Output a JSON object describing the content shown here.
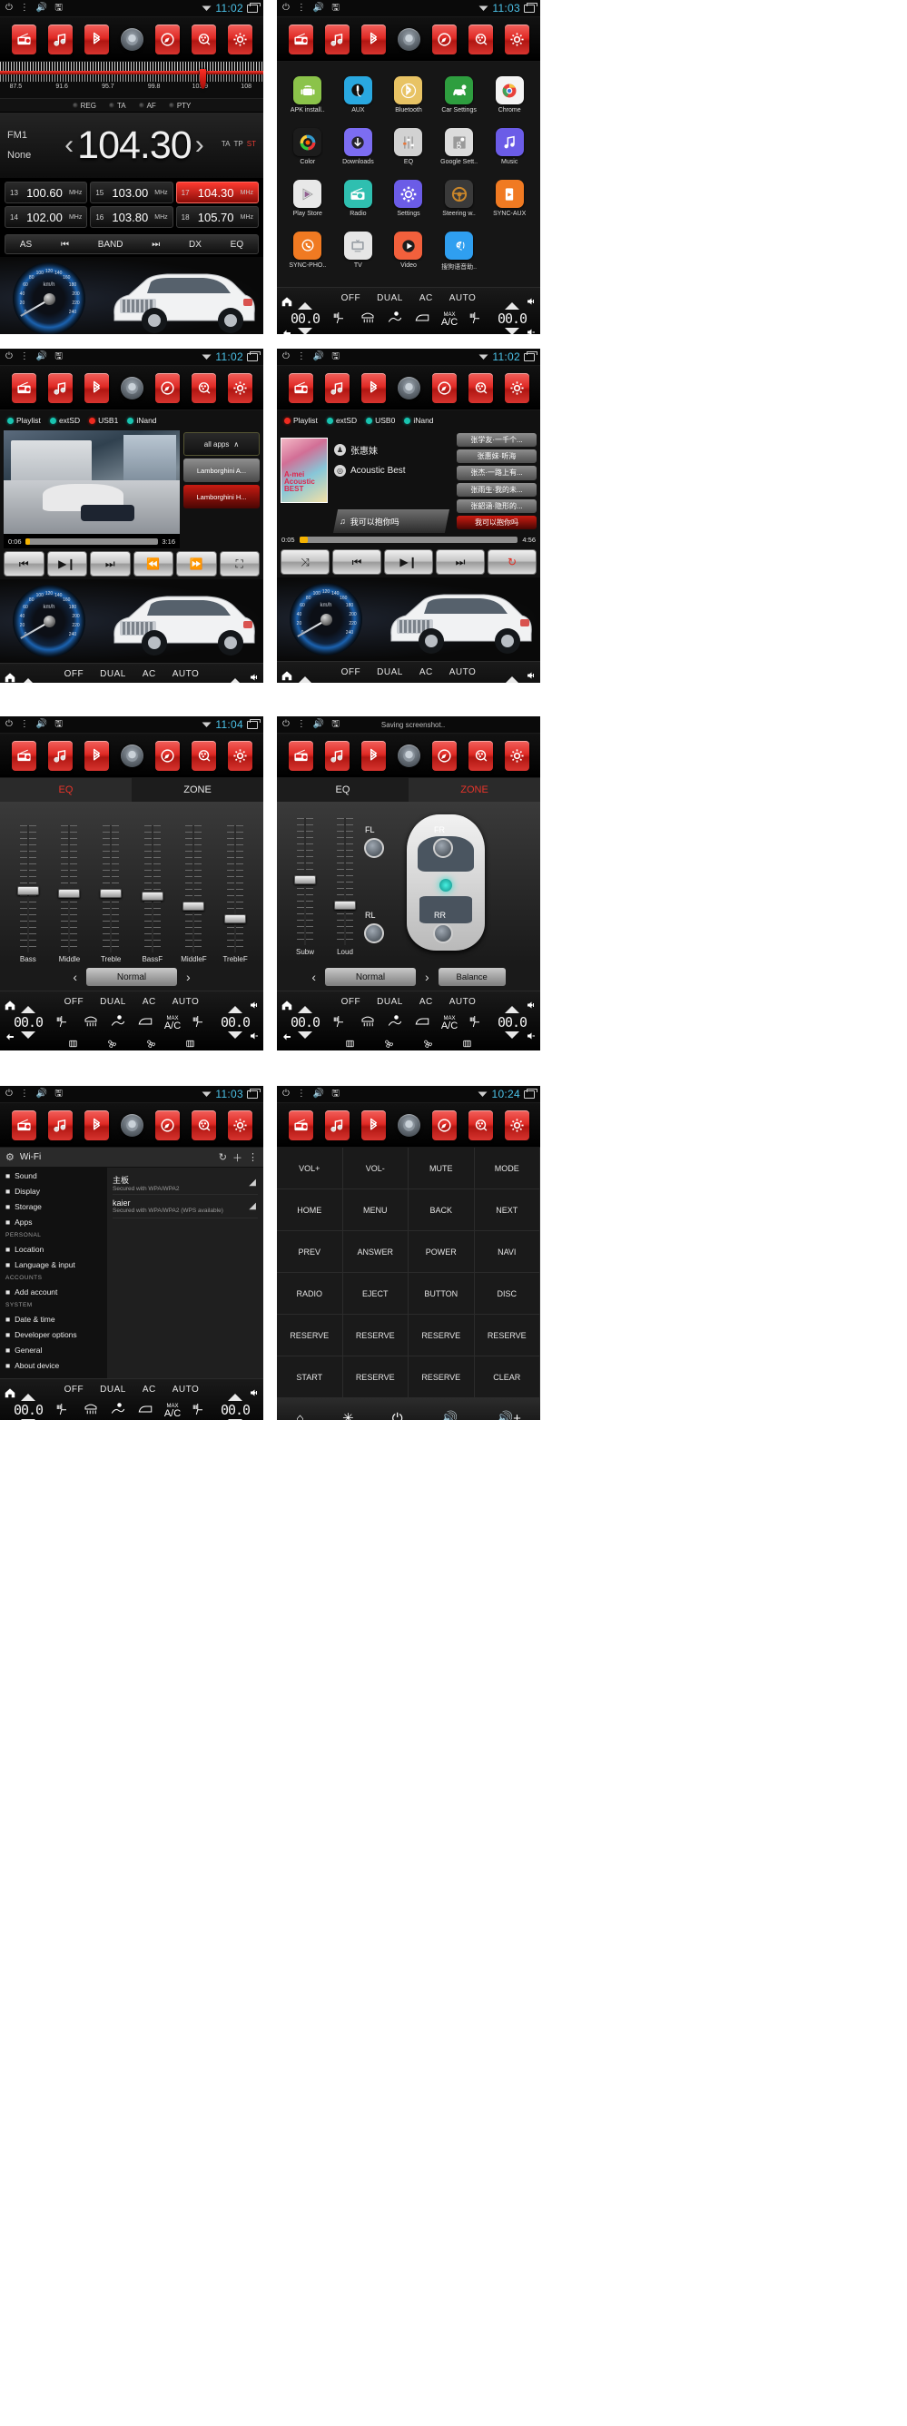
{
  "statusbar": {
    "time_1": "11:02",
    "time_2": "11:03",
    "time_3": "11:02",
    "time_4": "11:02",
    "time_5": "11:04",
    "time_6": "",
    "time_7": "11:03",
    "time_8": "10:24",
    "screenshot_note": "Saving screenshot..",
    "power_icon": "power-icon",
    "menu_icon": "overflow-menu-icon",
    "volume_icon": "volume-icon",
    "usb_icon": "usb-storage-icon",
    "wifi_icon": "wifi-icon",
    "recents_icon": "recent-apps-icon"
  },
  "iconbar": {
    "items": [
      {
        "name": "radio",
        "icon": "radio-icon"
      },
      {
        "name": "music",
        "icon": "music-note-icon"
      },
      {
        "name": "bluetooth",
        "icon": "bluetooth-icon"
      },
      {
        "name": "power",
        "icon": "power-orb-icon"
      },
      {
        "name": "navigation",
        "icon": "compass-icon"
      },
      {
        "name": "video",
        "icon": "film-reel-icon"
      },
      {
        "name": "settings",
        "icon": "gear-icon"
      }
    ]
  },
  "radio": {
    "scale_labels": [
      "87.5",
      "91.6",
      "95.7",
      "99.8",
      "103.9",
      "108"
    ],
    "rds": [
      "REG",
      "TA",
      "AF",
      "PTY"
    ],
    "band": "FM1",
    "pty": "None",
    "frequency": "104.30",
    "prev_chevron": "‹",
    "next_chevron": "›",
    "indicators": [
      {
        "label": "TA",
        "active": false
      },
      {
        "label": "TP",
        "active": false
      },
      {
        "label": "ST",
        "active": true
      }
    ],
    "presets": [
      {
        "num": "13",
        "freq": "100.60",
        "unit": "MHz",
        "active": false
      },
      {
        "num": "15",
        "freq": "103.00",
        "unit": "MHz",
        "active": false
      },
      {
        "num": "17",
        "freq": "104.30",
        "unit": "MHz",
        "active": true
      },
      {
        "num": "14",
        "freq": "102.00",
        "unit": "MHz",
        "active": false
      },
      {
        "num": "16",
        "freq": "103.80",
        "unit": "MHz",
        "active": false
      },
      {
        "num": "18",
        "freq": "105.70",
        "unit": "MHz",
        "active": false
      }
    ],
    "bottom_bar": [
      "AS",
      "⏮",
      "BAND",
      "⏭",
      "DX",
      "EQ"
    ]
  },
  "apps": {
    "items": [
      {
        "label": "APK install..",
        "color": "#8bc34a",
        "glyph": "●",
        "icon": "android-robot-icon"
      },
      {
        "label": "AUX",
        "color": "#29a8e0",
        "glyph": "⬤",
        "icon": "aux-plug-icon"
      },
      {
        "label": "Bluetooth",
        "color": "#e8c364",
        "glyph": "Ƀ",
        "icon": "bluetooth-icon"
      },
      {
        "label": "Car Settings",
        "color": "#2e9e3f",
        "glyph": "⛭",
        "icon": "car-settings-icon"
      },
      {
        "label": "Chrome",
        "color": "#f4f4f4",
        "glyph": "◉",
        "icon": "chrome-icon"
      },
      {
        "label": "Color",
        "color": "#1c1c1c",
        "glyph": "◎",
        "icon": "color-wheel-icon"
      },
      {
        "label": "Downloads",
        "color": "#7c6df2",
        "glyph": "↓",
        "icon": "download-arrow-icon"
      },
      {
        "label": "EQ",
        "color": "#d2d2d2",
        "glyph": "≡",
        "icon": "equalizer-sliders-icon"
      },
      {
        "label": "Google Sett..",
        "color": "#dcdcdc",
        "glyph": "g",
        "icon": "google-settings-icon"
      },
      {
        "label": "Music",
        "color": "#6b5ce7",
        "glyph": "♫",
        "icon": "music-note-icon"
      },
      {
        "label": "Play Store",
        "color": "#e8e8e8",
        "glyph": "▶",
        "icon": "play-store-icon"
      },
      {
        "label": "Radio",
        "color": "#2fbfb0",
        "glyph": "▣",
        "icon": "radio-icon"
      },
      {
        "label": "Settings",
        "color": "#6b5ce7",
        "glyph": "⚙",
        "icon": "gear-icon"
      },
      {
        "label": "Steering w..",
        "color": "#3a3a3a",
        "glyph": "◌",
        "icon": "steering-wheel-icon"
      },
      {
        "label": "SYNC-AUX",
        "color": "#f07a22",
        "glyph": "▶",
        "icon": "sync-aux-icon"
      },
      {
        "label": "SYNC-PHO..",
        "color": "#f07a22",
        "glyph": "☎",
        "icon": "sync-phone-icon"
      },
      {
        "label": "TV",
        "color": "#e6e6e6",
        "glyph": "□",
        "icon": "tv-icon"
      },
      {
        "label": "Video",
        "color": "#f2603c",
        "glyph": "▶",
        "icon": "video-play-icon"
      },
      {
        "label": "搜狗语音助..",
        "color": "#2f9ff0",
        "glyph": "S",
        "icon": "sogou-voice-icon"
      }
    ]
  },
  "dash": {
    "gauge_unit": "km/h",
    "gauge_ticks": [
      "0",
      "20",
      "40",
      "60",
      "80",
      "100",
      "120",
      "140",
      "160",
      "180",
      "200",
      "220",
      "240"
    ],
    "car_image": "white-suv-image"
  },
  "climate": {
    "row1": [
      "OFF",
      "DUAL",
      "AC",
      "AUTO"
    ],
    "temp_left": "00.0",
    "temp_right": "00.0",
    "max_label": "MAX",
    "ac_label": "A/C",
    "home_icon": "home-icon",
    "back_icon": "back-arrow-icon",
    "vol_up_icon": "volume-up-icon",
    "vol_down_icon": "volume-down-icon",
    "up_icon": "chevron-up-icon",
    "down_icon": "chevron-down-icon",
    "icons": [
      "seat-heat-icon",
      "max-defrost-icon",
      "face-vent-icon",
      "windshield-vent-icon",
      "ac-max-icon",
      "seat-heat-right-icon",
      "rear-defrost-icon",
      "fan-icon",
      "fan-right-icon",
      "rear-window-icon"
    ]
  },
  "video_player": {
    "sources": [
      {
        "label": "Playlist",
        "active": false
      },
      {
        "label": "extSD",
        "active": false
      },
      {
        "label": "USB1",
        "active": true
      },
      {
        "label": "iNand",
        "active": false
      }
    ],
    "elapsed": "0:06",
    "duration": "3:16",
    "playlist_header": "all apps",
    "playlist_chevron": "∧",
    "playlist_items": [
      {
        "label": "Lamborghini A...",
        "selected": false
      },
      {
        "label": "Lamborghini H...",
        "selected": true
      }
    ],
    "transport": [
      "⏮",
      "▶❙",
      "⏭",
      "⏪",
      "⏩",
      "⛶"
    ],
    "transport_names": [
      "prev-track-button",
      "play-pause-button",
      "next-track-button",
      "rewind-button",
      "fast-forward-button",
      "fullscreen-button"
    ]
  },
  "music_player": {
    "sources": [
      {
        "label": "Playlist",
        "active": true
      },
      {
        "label": "extSD",
        "active": false
      },
      {
        "label": "USB0",
        "active": false
      },
      {
        "label": "iNand",
        "active": false
      }
    ],
    "artist": "张惠妹",
    "album": "Acoustic Best",
    "track": "我可以抱你吗",
    "album_art_text": "A-mei Acoustic BEST",
    "elapsed": "0:05",
    "duration": "4:56",
    "playlist_items": [
      {
        "label": "张学友·一千个...",
        "selected": false
      },
      {
        "label": "张惠妹·听海",
        "selected": false
      },
      {
        "label": "张杰·一路上有...",
        "selected": false
      },
      {
        "label": "张雨生·我的未...",
        "selected": false
      },
      {
        "label": "张韶涵·隐形的...",
        "selected": false
      },
      {
        "label": "我可以抱你吗",
        "selected": true
      }
    ],
    "transport": [
      "⤨",
      "⏮",
      "▶❙",
      "⏭",
      "↻"
    ],
    "transport_names": [
      "shuffle-button",
      "prev-track-button",
      "play-pause-button",
      "next-track-button",
      "repeat-button"
    ]
  },
  "eq": {
    "tabs": [
      {
        "label": "EQ",
        "active": true
      },
      {
        "label": "ZONE",
        "active": false
      }
    ],
    "sliders": [
      {
        "label": "Bass",
        "value": 52
      },
      {
        "label": "Middle",
        "value": 50
      },
      {
        "label": "Treble",
        "value": 50
      },
      {
        "label": "BassF",
        "value": 48
      },
      {
        "label": "MiddleF",
        "value": 40
      },
      {
        "label": "TrebleF",
        "value": 30
      }
    ],
    "preset": "Normal",
    "prev_icon": "‹",
    "next_icon": "›"
  },
  "zone": {
    "tabs": [
      {
        "label": "EQ",
        "active": false
      },
      {
        "label": "ZONE",
        "active": true
      }
    ],
    "sliders": [
      {
        "label": "Subw",
        "value": 55
      },
      {
        "label": "Loud",
        "value": 35
      }
    ],
    "speakers": [
      "FL",
      "FR",
      "RL",
      "RR"
    ],
    "preset": "Normal",
    "balance_label": "Balance",
    "prev_icon": "‹",
    "next_icon": "›"
  },
  "settings": {
    "header": "Wi-Fi",
    "header_icon": "gear-icon",
    "actions": [
      "refresh-icon",
      "add-icon",
      "overflow-menu-icon"
    ],
    "toggle_on": true,
    "list": [
      {
        "type": "item",
        "label": "Sound",
        "icon": "sound-icon"
      },
      {
        "type": "item",
        "label": "Display",
        "icon": "display-icon"
      },
      {
        "type": "item",
        "label": "Storage",
        "icon": "storage-icon"
      },
      {
        "type": "item",
        "label": "Apps",
        "icon": "apps-icon"
      },
      {
        "type": "section",
        "label": "PERSONAL"
      },
      {
        "type": "item",
        "label": "Location",
        "icon": "location-icon"
      },
      {
        "type": "item",
        "label": "Language & input",
        "icon": "language-icon"
      },
      {
        "type": "section",
        "label": "ACCOUNTS"
      },
      {
        "type": "item",
        "label": "Add account",
        "icon": "plus-icon"
      },
      {
        "type": "section",
        "label": "SYSTEM"
      },
      {
        "type": "item",
        "label": "Date & time",
        "icon": "clock-icon"
      },
      {
        "type": "item",
        "label": "Developer options",
        "icon": "developer-icon"
      },
      {
        "type": "item",
        "label": "General",
        "icon": "general-icon"
      },
      {
        "type": "item",
        "label": "About device",
        "icon": "info-icon"
      }
    ],
    "networks": [
      {
        "ssid": "主板",
        "security": "Secured with WPA/WPA2"
      },
      {
        "ssid": "kaier",
        "security": "Secured with WPA/WPA2 (WPS available)"
      }
    ]
  },
  "keypad": {
    "keys": [
      "VOL+",
      "VOL-",
      "MUTE",
      "MODE",
      "HOME",
      "MENU",
      "BACK",
      "NEXT",
      "PREV",
      "ANSWER",
      "POWER",
      "NAVI",
      "RADIO",
      "EJECT",
      "BUTTON",
      "DISC",
      "RESERVE",
      "RESERVE",
      "RESERVE",
      "RESERVE",
      "START",
      "RESERVE",
      "RESERVE",
      "CLEAR"
    ],
    "navbar": [
      "home-icon",
      "snowflake-icon",
      "power-icon",
      "volume-icon",
      "volume-up-icon"
    ],
    "navbar2": [
      "back-arrow-icon",
      "recents-icon"
    ]
  }
}
